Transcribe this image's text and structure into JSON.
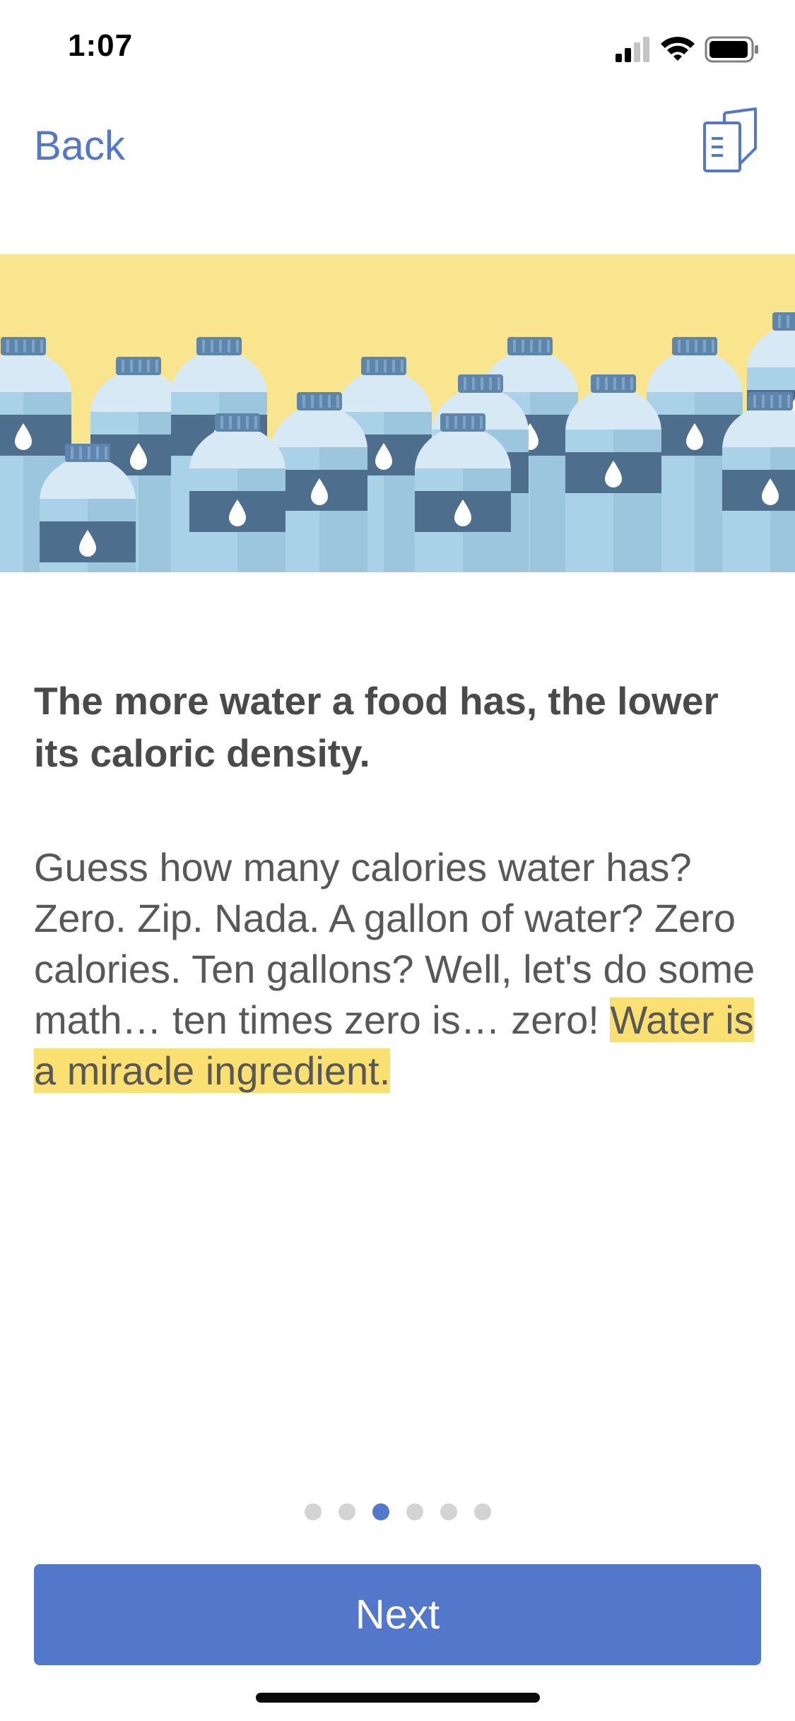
{
  "status_bar": {
    "time": "1:07",
    "icons": [
      "cellular-signal-icon",
      "wifi-icon",
      "battery-icon"
    ]
  },
  "nav": {
    "back_label": "Back",
    "right_icon": "book-icon"
  },
  "hero": {
    "illustration": "water-bottles-illustration",
    "background_color": "#f9e58d"
  },
  "content": {
    "headline": "The more water a food has, the lower its caloric density.",
    "body_plain": "Guess how many calories water has?  Zero.  Zip.  Nada.  A gallon of water?  Zero calories.  Ten gallons?  Well, let's do some math… ten times zero is… zero!  ",
    "body_highlight": "Water is a miracle ingredient."
  },
  "pager": {
    "total_pages": 6,
    "current_page": 3
  },
  "footer": {
    "next_label": "Next"
  },
  "colors": {
    "accent": "#5277cb",
    "highlight": "#f9e070",
    "text_dark": "#4a4a4a",
    "text_body": "#585858"
  }
}
